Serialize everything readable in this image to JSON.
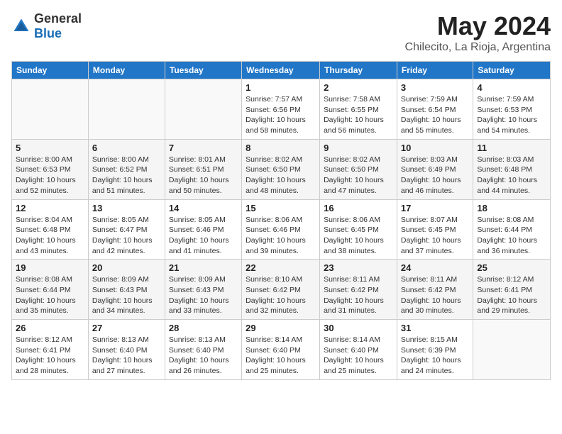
{
  "header": {
    "logo": {
      "text_general": "General",
      "text_blue": "Blue"
    },
    "title": "May 2024",
    "location": "Chilecito, La Rioja, Argentina"
  },
  "calendar": {
    "days_of_week": [
      "Sunday",
      "Monday",
      "Tuesday",
      "Wednesday",
      "Thursday",
      "Friday",
      "Saturday"
    ],
    "weeks": [
      {
        "days": [
          {
            "number": "",
            "info": ""
          },
          {
            "number": "",
            "info": ""
          },
          {
            "number": "",
            "info": ""
          },
          {
            "number": "1",
            "info": "Sunrise: 7:57 AM\nSunset: 6:56 PM\nDaylight: 10 hours and 58 minutes."
          },
          {
            "number": "2",
            "info": "Sunrise: 7:58 AM\nSunset: 6:55 PM\nDaylight: 10 hours and 56 minutes."
          },
          {
            "number": "3",
            "info": "Sunrise: 7:59 AM\nSunset: 6:54 PM\nDaylight: 10 hours and 55 minutes."
          },
          {
            "number": "4",
            "info": "Sunrise: 7:59 AM\nSunset: 6:53 PM\nDaylight: 10 hours and 54 minutes."
          }
        ]
      },
      {
        "days": [
          {
            "number": "5",
            "info": "Sunrise: 8:00 AM\nSunset: 6:53 PM\nDaylight: 10 hours and 52 minutes."
          },
          {
            "number": "6",
            "info": "Sunrise: 8:00 AM\nSunset: 6:52 PM\nDaylight: 10 hours and 51 minutes."
          },
          {
            "number": "7",
            "info": "Sunrise: 8:01 AM\nSunset: 6:51 PM\nDaylight: 10 hours and 50 minutes."
          },
          {
            "number": "8",
            "info": "Sunrise: 8:02 AM\nSunset: 6:50 PM\nDaylight: 10 hours and 48 minutes."
          },
          {
            "number": "9",
            "info": "Sunrise: 8:02 AM\nSunset: 6:50 PM\nDaylight: 10 hours and 47 minutes."
          },
          {
            "number": "10",
            "info": "Sunrise: 8:03 AM\nSunset: 6:49 PM\nDaylight: 10 hours and 46 minutes."
          },
          {
            "number": "11",
            "info": "Sunrise: 8:03 AM\nSunset: 6:48 PM\nDaylight: 10 hours and 44 minutes."
          }
        ]
      },
      {
        "days": [
          {
            "number": "12",
            "info": "Sunrise: 8:04 AM\nSunset: 6:48 PM\nDaylight: 10 hours and 43 minutes."
          },
          {
            "number": "13",
            "info": "Sunrise: 8:05 AM\nSunset: 6:47 PM\nDaylight: 10 hours and 42 minutes."
          },
          {
            "number": "14",
            "info": "Sunrise: 8:05 AM\nSunset: 6:46 PM\nDaylight: 10 hours and 41 minutes."
          },
          {
            "number": "15",
            "info": "Sunrise: 8:06 AM\nSunset: 6:46 PM\nDaylight: 10 hours and 39 minutes."
          },
          {
            "number": "16",
            "info": "Sunrise: 8:06 AM\nSunset: 6:45 PM\nDaylight: 10 hours and 38 minutes."
          },
          {
            "number": "17",
            "info": "Sunrise: 8:07 AM\nSunset: 6:45 PM\nDaylight: 10 hours and 37 minutes."
          },
          {
            "number": "18",
            "info": "Sunrise: 8:08 AM\nSunset: 6:44 PM\nDaylight: 10 hours and 36 minutes."
          }
        ]
      },
      {
        "days": [
          {
            "number": "19",
            "info": "Sunrise: 8:08 AM\nSunset: 6:44 PM\nDaylight: 10 hours and 35 minutes."
          },
          {
            "number": "20",
            "info": "Sunrise: 8:09 AM\nSunset: 6:43 PM\nDaylight: 10 hours and 34 minutes."
          },
          {
            "number": "21",
            "info": "Sunrise: 8:09 AM\nSunset: 6:43 PM\nDaylight: 10 hours and 33 minutes."
          },
          {
            "number": "22",
            "info": "Sunrise: 8:10 AM\nSunset: 6:42 PM\nDaylight: 10 hours and 32 minutes."
          },
          {
            "number": "23",
            "info": "Sunrise: 8:11 AM\nSunset: 6:42 PM\nDaylight: 10 hours and 31 minutes."
          },
          {
            "number": "24",
            "info": "Sunrise: 8:11 AM\nSunset: 6:42 PM\nDaylight: 10 hours and 30 minutes."
          },
          {
            "number": "25",
            "info": "Sunrise: 8:12 AM\nSunset: 6:41 PM\nDaylight: 10 hours and 29 minutes."
          }
        ]
      },
      {
        "days": [
          {
            "number": "26",
            "info": "Sunrise: 8:12 AM\nSunset: 6:41 PM\nDaylight: 10 hours and 28 minutes."
          },
          {
            "number": "27",
            "info": "Sunrise: 8:13 AM\nSunset: 6:40 PM\nDaylight: 10 hours and 27 minutes."
          },
          {
            "number": "28",
            "info": "Sunrise: 8:13 AM\nSunset: 6:40 PM\nDaylight: 10 hours and 26 minutes."
          },
          {
            "number": "29",
            "info": "Sunrise: 8:14 AM\nSunset: 6:40 PM\nDaylight: 10 hours and 25 minutes."
          },
          {
            "number": "30",
            "info": "Sunrise: 8:14 AM\nSunset: 6:40 PM\nDaylight: 10 hours and 25 minutes."
          },
          {
            "number": "31",
            "info": "Sunrise: 8:15 AM\nSunset: 6:39 PM\nDaylight: 10 hours and 24 minutes."
          },
          {
            "number": "",
            "info": ""
          }
        ]
      }
    ]
  }
}
